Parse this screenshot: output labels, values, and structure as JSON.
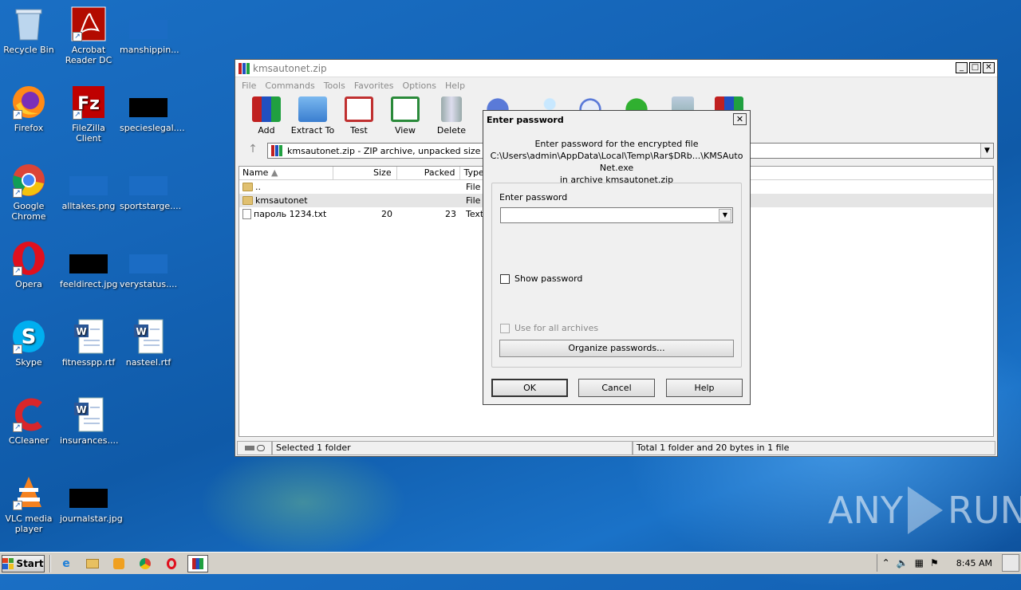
{
  "desktop": {
    "icons": [
      {
        "label": "Recycle Bin",
        "icon": "recycle-bin-icon"
      },
      {
        "label": "Acrobat Reader DC",
        "icon": "acrobat-reader-icon"
      },
      {
        "label": "manshippin...",
        "icon": "file-icon"
      },
      {
        "label": "Firefox",
        "icon": "firefox-icon"
      },
      {
        "label": "FileZilla Client",
        "icon": "filezilla-icon"
      },
      {
        "label": "specieslegal....",
        "icon": "file-icon"
      },
      {
        "label": "Google Chrome",
        "icon": "chrome-icon"
      },
      {
        "label": "alltakes.png",
        "icon": "image-file-icon"
      },
      {
        "label": "sportstarge....",
        "icon": "file-icon"
      },
      {
        "label": "Opera",
        "icon": "opera-icon"
      },
      {
        "label": "feeldirect.jpg",
        "icon": "image-file-icon"
      },
      {
        "label": "verystatus....",
        "icon": "file-icon"
      },
      {
        "label": "Skype",
        "icon": "skype-icon"
      },
      {
        "label": "fitnesspp.rtf",
        "icon": "word-doc-icon"
      },
      {
        "label": "nasteel.rtf",
        "icon": "word-doc-icon"
      },
      {
        "label": "CCleaner",
        "icon": "ccleaner-icon"
      },
      {
        "label": "insurances....",
        "icon": "word-doc-icon"
      },
      {
        "label": "VLC media player",
        "icon": "vlc-icon"
      },
      {
        "label": "journalstar.jpg",
        "icon": "image-file-icon"
      }
    ]
  },
  "winrar": {
    "title": "kmsautonet.zip",
    "menu": [
      "File",
      "Commands",
      "Tools",
      "Favorites",
      "Options",
      "Help"
    ],
    "toolbar": [
      "Add",
      "Extract To",
      "Test",
      "View",
      "Delete"
    ],
    "address": "kmsautonet.zip - ZIP archive, unpacked size 8,5",
    "columns": [
      "Name",
      "Size",
      "Packed",
      "Type"
    ],
    "rows": [
      {
        "name": "..",
        "size": "",
        "packed": "",
        "type": "File f"
      },
      {
        "name": "kmsautonet",
        "size": "",
        "packed": "",
        "type": "File f"
      },
      {
        "name": "пароль 1234.txt",
        "size": "20",
        "packed": "23",
        "type": "Text"
      }
    ],
    "status_left": "Selected 1 folder",
    "status_right": "Total 1 folder and 20 bytes in 1 file",
    "window_buttons": {
      "minimize": "_",
      "maximize": "□",
      "close": "✕"
    }
  },
  "dialog": {
    "title": "Enter password",
    "info_line1": "Enter password for the encrypted file",
    "info_line2": "C:\\Users\\admin\\AppData\\Local\\Temp\\Rar$DRb...\\KMSAuto Net.exe",
    "info_line3": "in archive kmsautonet.zip",
    "password_label": "Enter password",
    "password_value": "",
    "show_password": "Show password",
    "use_for_all": "Use for all archives",
    "organize": "Organize passwords...",
    "ok": "OK",
    "cancel": "Cancel",
    "help": "Help"
  },
  "taskbar": {
    "start": "Start",
    "clock": "8:45 AM"
  },
  "watermark": {
    "text_left": "ANY",
    "text_right": "RUN"
  },
  "colors": {
    "desktop": "#1565b8",
    "selection": "#e5e5e5"
  }
}
